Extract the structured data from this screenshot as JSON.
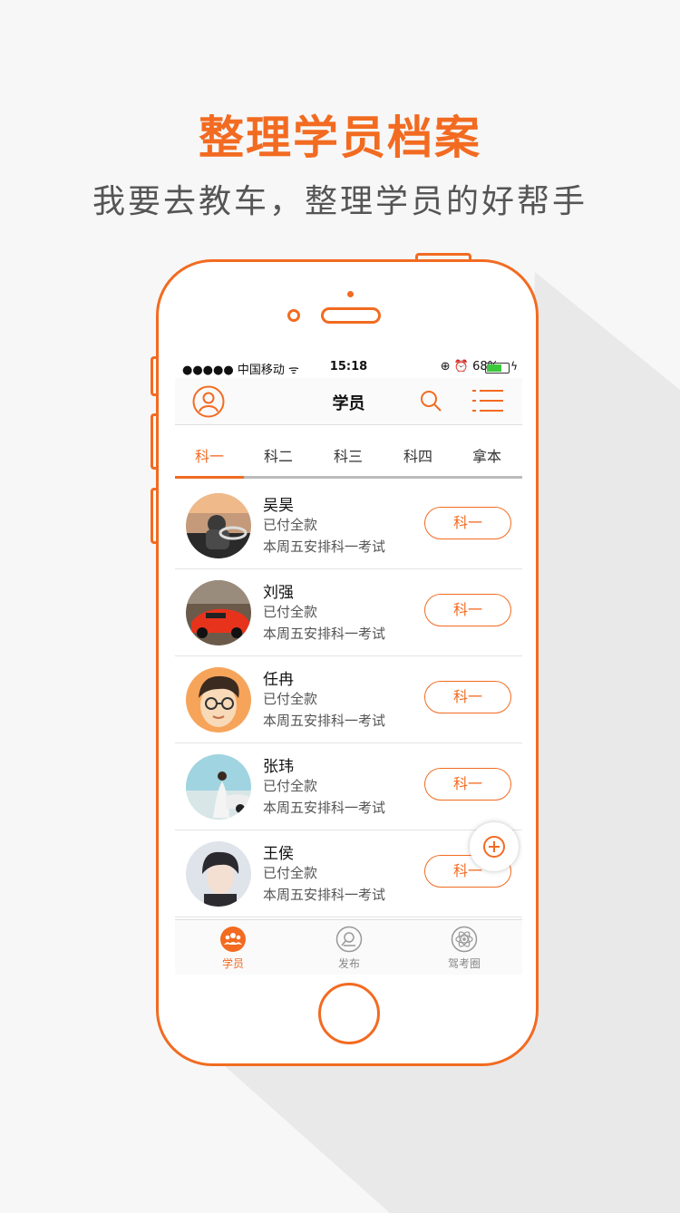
{
  "promo": {
    "headline": "整理学员档案",
    "subline": "我要去教车，整理学员的好帮手"
  },
  "status_bar": {
    "carrier": "●●●●● 中国移动 ᯤ",
    "time": "15:18",
    "right": "⊕ ⏰ 68%",
    "battery_level": 0.68
  },
  "nav": {
    "title": "学员",
    "icons": [
      "profile-icon",
      "search-icon",
      "menu-list-icon"
    ]
  },
  "tabs": [
    {
      "label": "科一",
      "active": true
    },
    {
      "label": "科二",
      "active": false
    },
    {
      "label": "科三",
      "active": false
    },
    {
      "label": "科四",
      "active": false
    },
    {
      "label": "拿本",
      "active": false
    }
  ],
  "students": [
    {
      "name": "吴昊",
      "payment": "已付全款",
      "schedule": "本周五安排科一考试",
      "stage": "科一"
    },
    {
      "name": "刘强",
      "payment": "已付全款",
      "schedule": "本周五安排科一考试",
      "stage": "科一"
    },
    {
      "name": "任冉",
      "payment": "已付全款",
      "schedule": "本周五安排科一考试",
      "stage": "科一"
    },
    {
      "name": "张玮",
      "payment": "已付全款",
      "schedule": "本周五安排科一考试",
      "stage": "科一"
    },
    {
      "name": "王侯",
      "payment": "已付全款",
      "schedule": "本周五安排科一考试",
      "stage": "科一"
    }
  ],
  "tabbar": [
    {
      "label": "学员",
      "icon": "students-icon",
      "active": true
    },
    {
      "label": "发布",
      "icon": "publish-icon",
      "active": false
    },
    {
      "label": "驾考圈",
      "icon": "community-icon",
      "active": false
    }
  ],
  "colors": {
    "accent": "#f26b21",
    "text": "#111111",
    "muted": "#555555",
    "background": "#f7f7f7"
  }
}
